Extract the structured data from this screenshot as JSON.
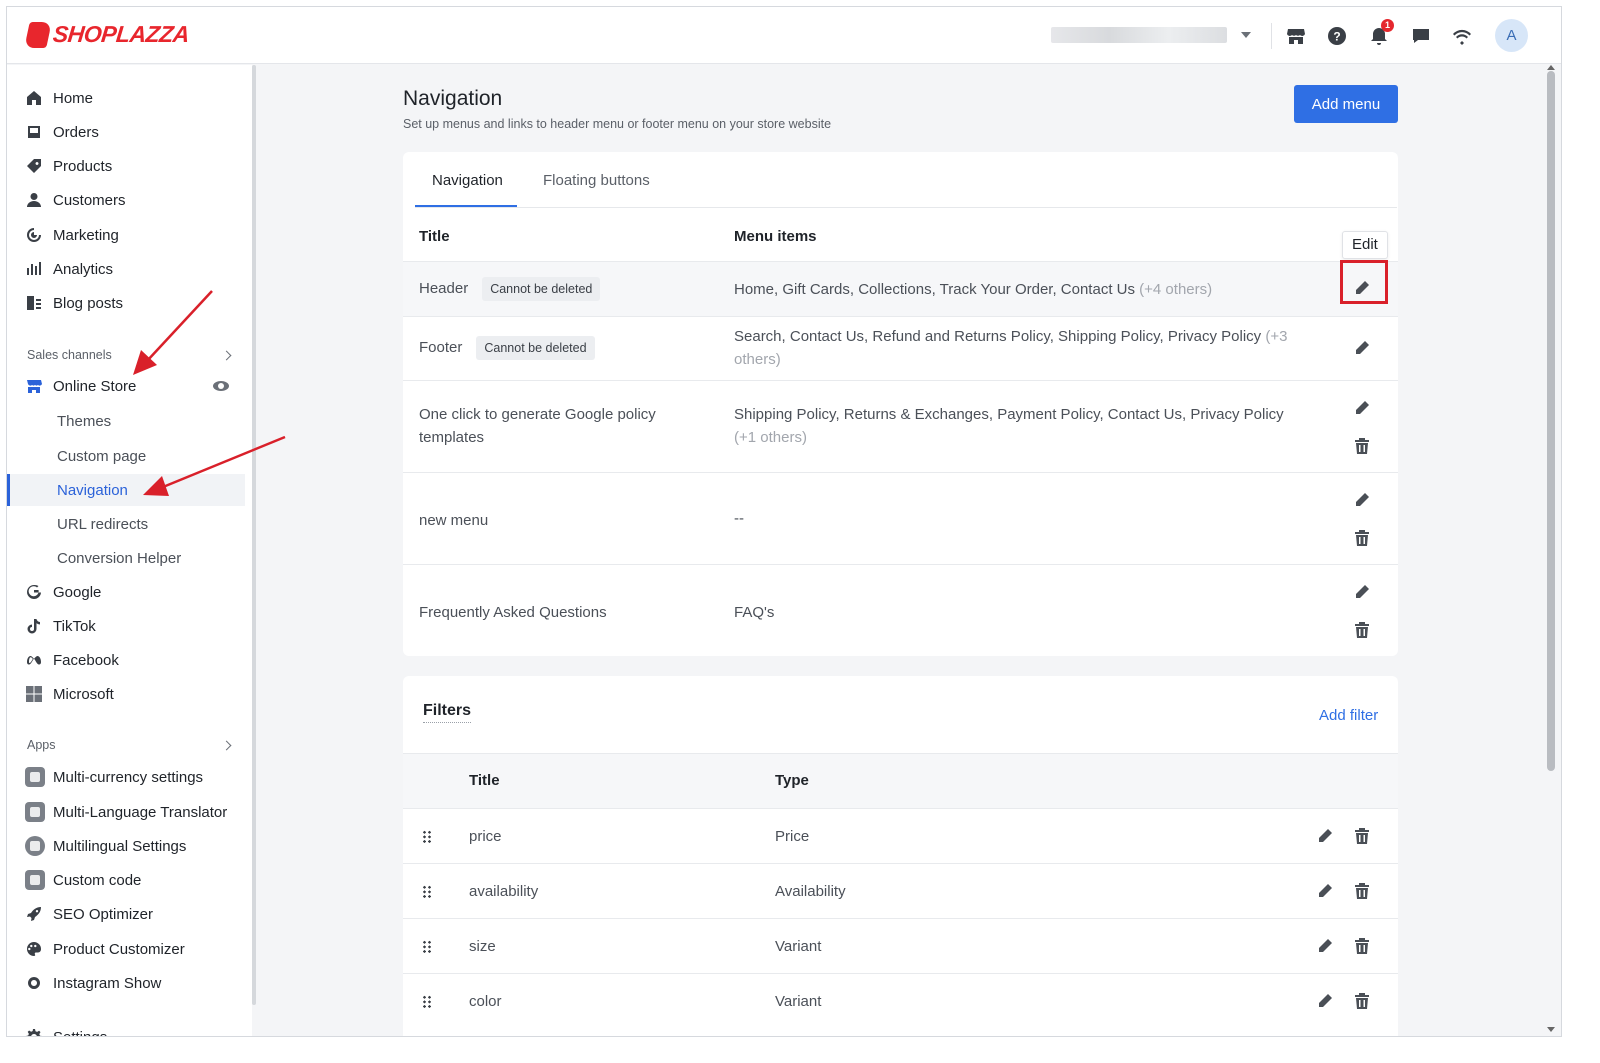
{
  "brand": {
    "name": "SHOPLAZZA"
  },
  "topbar": {
    "notification_count": "1",
    "avatar_letter": "A"
  },
  "sidebar": {
    "items": [
      {
        "label": "Home",
        "icon": "home-icon"
      },
      {
        "label": "Orders",
        "icon": "orders-icon"
      },
      {
        "label": "Products",
        "icon": "tag-icon"
      },
      {
        "label": "Customers",
        "icon": "person-icon"
      },
      {
        "label": "Marketing",
        "icon": "marketing-icon"
      },
      {
        "label": "Analytics",
        "icon": "bar-chart-icon"
      },
      {
        "label": "Blog posts",
        "icon": "blog-icon"
      }
    ],
    "sales_channels_label": "Sales channels",
    "online_store_label": "Online Store",
    "online_store_sub": [
      "Themes",
      "Custom page",
      "Navigation",
      "URL redirects",
      "Conversion Helper"
    ],
    "channels": [
      {
        "label": "Google",
        "icon": "google-icon"
      },
      {
        "label": "TikTok",
        "icon": "tiktok-icon"
      },
      {
        "label": "Facebook",
        "icon": "meta-icon"
      },
      {
        "label": "Microsoft",
        "icon": "microsoft-icon"
      }
    ],
    "apps_label": "Apps",
    "apps": [
      "Multi-currency settings",
      "Multi-Language Translator",
      "Multilingual Settings",
      "Custom code",
      "SEO Optimizer",
      "Product Customizer",
      "Instagram Show"
    ],
    "settings_label": "Settings"
  },
  "page": {
    "title": "Navigation",
    "subtitle": "Set up menus and links to header menu or footer menu on your store website",
    "add_menu_label": "Add menu"
  },
  "tabs": [
    "Navigation",
    "Floating buttons"
  ],
  "menus": {
    "col_title": "Title",
    "col_items": "Menu items",
    "tooltip": "Edit",
    "badge": "Cannot be deleted",
    "rows": [
      {
        "title": "Header",
        "items": "Home, Gift Cards, Collections, Track Your Order, Contact Us",
        "extra": "(+4 others)"
      },
      {
        "title": "Footer",
        "items": "Search, Contact Us, Refund and Returns Policy, Shipping Policy, Privacy Policy",
        "extra": "(+3 others)"
      },
      {
        "title": "One click to generate Google policy templates",
        "items": "Shipping Policy, Returns & Exchanges, Payment Policy, Contact Us, Privacy Policy",
        "extra": "(+1 others)"
      },
      {
        "title": "new menu",
        "items": "--",
        "extra": ""
      },
      {
        "title": "Frequently Asked Questions",
        "items": "FAQ's",
        "extra": ""
      }
    ]
  },
  "filters": {
    "title": "Filters",
    "add_label": "Add filter",
    "col_title": "Title",
    "col_type": "Type",
    "rows": [
      {
        "title": "price",
        "type": "Price"
      },
      {
        "title": "availability",
        "type": "Availability"
      },
      {
        "title": "size",
        "type": "Variant"
      },
      {
        "title": "color",
        "type": "Variant"
      }
    ]
  },
  "colors": {
    "accent": "#2f6fe4",
    "brand": "#e8262d",
    "highlight": "#d9202a"
  }
}
